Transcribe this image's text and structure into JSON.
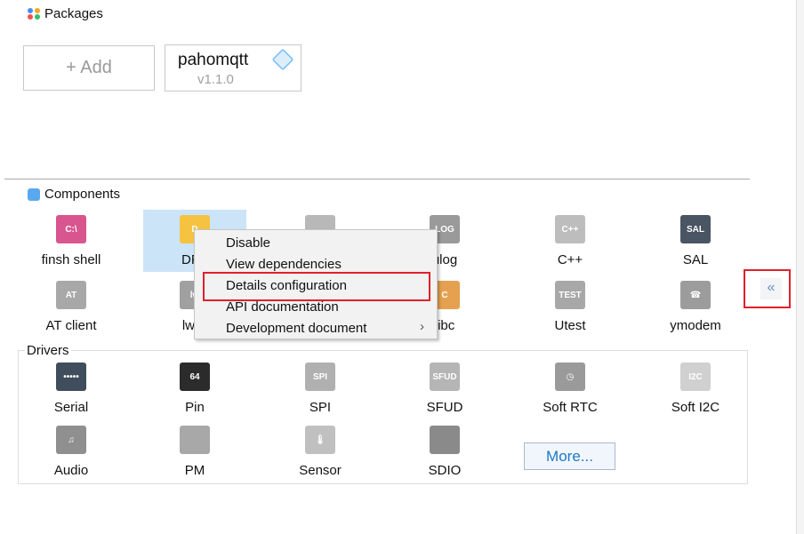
{
  "packages": {
    "title": "Packages",
    "add_label": "+  Add",
    "package": {
      "name": "pahomqtt",
      "version": "v1.1.0",
      "icon": "package-cube-icon"
    }
  },
  "components": {
    "title": "Components",
    "items": [
      {
        "label": "finsh shell",
        "icon": "terminal-icon",
        "glyph": "C:\\",
        "color": "#d9558f"
      },
      {
        "label": "DFS",
        "icon": "folder-icon",
        "glyph": "D",
        "color": "#f5c242",
        "selected": true
      },
      {
        "label": "",
        "icon": "folder-gray-icon",
        "glyph": "",
        "color": "#b8b8b8"
      },
      {
        "label": "ulog",
        "icon": "log-icon",
        "glyph": "LOG",
        "color": "#9a9a9a"
      },
      {
        "label": "C++",
        "icon": "cpp-file-icon",
        "glyph": "C++",
        "color": "#bdbdbd"
      },
      {
        "label": "SAL",
        "icon": "router-icon",
        "glyph": "SAL",
        "color": "#4a5563"
      },
      {
        "label": "AT client",
        "icon": "at-icon",
        "glyph": "AT",
        "color": "#a8a8a8"
      },
      {
        "label": "lwIP",
        "icon": "monitor-icon",
        "glyph": "lw",
        "color": "#a0a0a0"
      },
      {
        "label": "",
        "icon": "gray-icon",
        "glyph": "",
        "color": "#b8b8b8"
      },
      {
        "label": "libc",
        "icon": "books-icon",
        "glyph": "C",
        "color": "#e5a150"
      },
      {
        "label": "Utest",
        "icon": "flask-icon",
        "glyph": "TEST",
        "color": "#a8a8a8"
      },
      {
        "label": "ymodem",
        "icon": "telephone-icon",
        "glyph": "☎",
        "color": "#9c9c9c"
      }
    ]
  },
  "drivers": {
    "title": "Drivers",
    "more_label": "More...",
    "items": [
      {
        "label": "Serial",
        "icon": "serial-port-icon",
        "glyph": "•••••",
        "color": "#3f4d5c"
      },
      {
        "label": "Pin",
        "icon": "chip-icon",
        "glyph": "64",
        "color": "#2b2b2b"
      },
      {
        "label": "SPI",
        "icon": "spi-chip-icon",
        "glyph": "SPI",
        "color": "#b0b0b0"
      },
      {
        "label": "SFUD",
        "icon": "sfud-chip-icon",
        "glyph": "SFUD",
        "color": "#b5b5b5"
      },
      {
        "label": "Soft RTC",
        "icon": "clock-icon",
        "glyph": "◷",
        "color": "#9a9a9a"
      },
      {
        "label": "Soft I2C",
        "icon": "i2c-chip-icon",
        "glyph": "I2C",
        "color": "#d0d0d0"
      },
      {
        "label": "Audio",
        "icon": "headphones-icon",
        "glyph": "♫",
        "color": "#8f8f8f"
      },
      {
        "label": "PM",
        "icon": "battery-icon",
        "glyph": "",
        "color": "#a8a8a8"
      },
      {
        "label": "Sensor",
        "icon": "thermometer-icon",
        "glyph": "🌡",
        "color": "#c0c0c0"
      },
      {
        "label": "SDIO",
        "icon": "sd-card-icon",
        "glyph": "",
        "color": "#8a8a8a"
      }
    ]
  },
  "context_menu": {
    "items": [
      "Disable",
      "View dependencies",
      "Details configuration",
      "API documentation",
      "Development document"
    ],
    "submenu_arrow": "›",
    "highlighted": "Details configuration"
  },
  "collapse_button": {
    "label": "«"
  },
  "colors": {
    "highlight_box": "#e0202a",
    "selection": "#cce4f7",
    "accent": "#1f77c8"
  }
}
